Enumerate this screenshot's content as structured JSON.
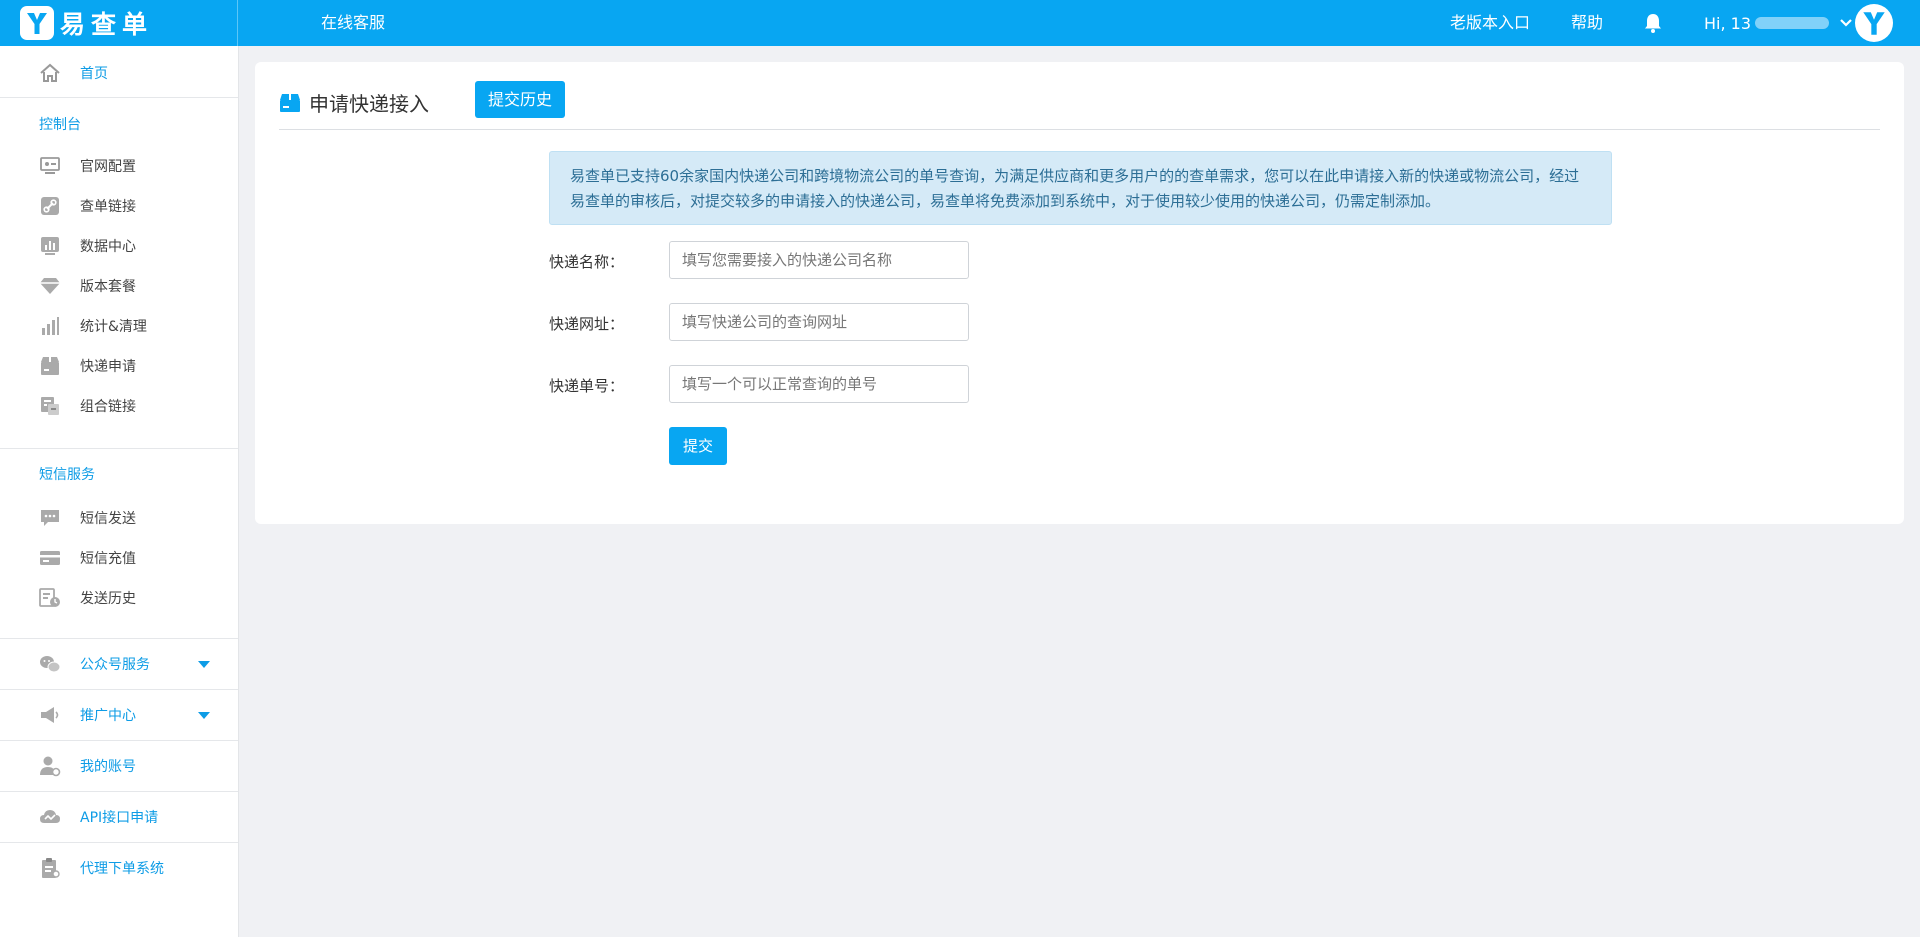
{
  "header": {
    "brand": "易查单",
    "online_service": "在线客服",
    "old_version": "老版本入口",
    "help": "帮助",
    "greeting": "Hi, 13",
    "accent_color": "#08a6f2"
  },
  "sidebar": {
    "home": "首页",
    "console_title": "控制台",
    "console_items": [
      "官网配置",
      "查单链接",
      "数据中心",
      "版本套餐",
      "统计&清理",
      "快递申请",
      "组合链接"
    ],
    "sms_title": "短信服务",
    "sms_items": [
      "短信发送",
      "短信充值",
      "发送历史"
    ],
    "wechat": "公众号服务",
    "promotion": "推广中心",
    "account": "我的账号",
    "api": "API接口申请",
    "agent": "代理下单系统"
  },
  "main": {
    "title": "申请快递接入",
    "history_button": "提交历史",
    "notice": "易查单已支持60余家国内快递公司和跨境物流公司的单号查询，为满足供应商和更多用户的的查单需求，您可以在此申请接入新的快递或物流公司，经过易查单的审核后，对提交较多的申请接入的快递公司，易查单将免费添加到系统中，对于使用较少使用的快递公司，仍需定制添加。",
    "fields": [
      {
        "label": "快递名称：",
        "placeholder": "填写您需要接入的快递公司名称",
        "value": ""
      },
      {
        "label": "快递网址：",
        "placeholder": "填写快递公司的查询网址",
        "value": ""
      },
      {
        "label": "快递单号：",
        "placeholder": "填写一个可以正常查询的单号",
        "value": ""
      }
    ],
    "submit": "提交"
  }
}
